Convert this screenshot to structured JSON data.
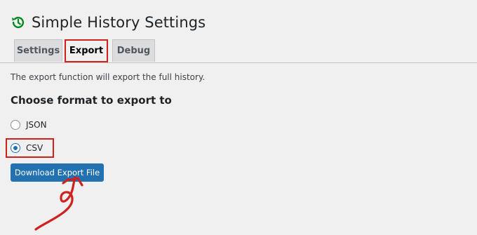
{
  "page": {
    "title": "Simple History Settings"
  },
  "tabs": [
    {
      "label": "Settings",
      "active": false
    },
    {
      "label": "Export",
      "active": true
    },
    {
      "label": "Debug",
      "active": false
    }
  ],
  "export": {
    "description": "The export function will export the full history.",
    "section_title": "Choose format to export to",
    "formats": [
      {
        "label": "JSON",
        "selected": false
      },
      {
        "label": "CSV",
        "selected": true
      }
    ],
    "download_button_label": "Download Export File"
  },
  "colors": {
    "accent": "#2271b1",
    "annotation": "#d0211c",
    "icon": "#008a20"
  }
}
